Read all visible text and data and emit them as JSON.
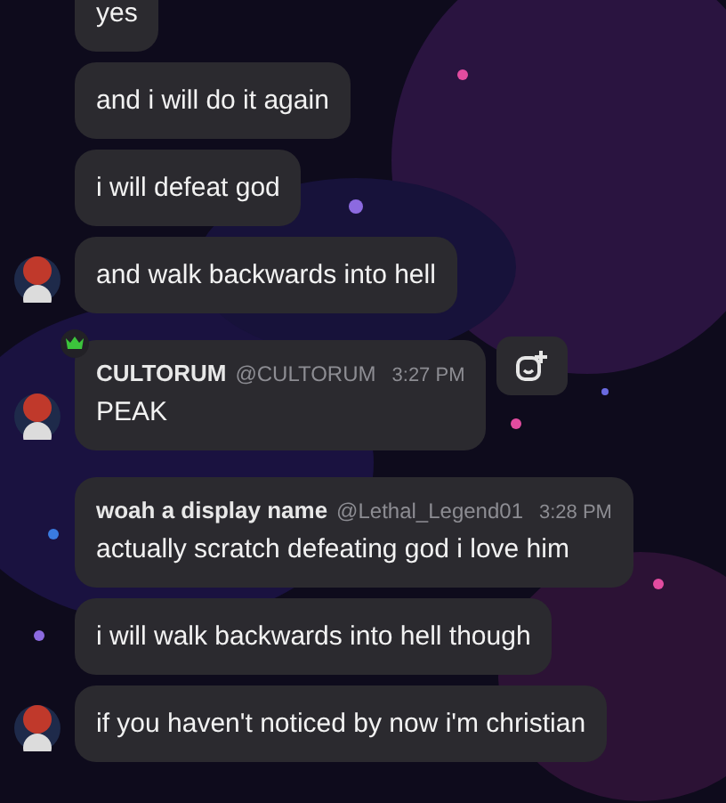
{
  "messages": [
    {
      "kind": "plain",
      "text": "yes",
      "avatar": false,
      "hovered": false
    },
    {
      "kind": "plain",
      "text": "and i will do it again",
      "avatar": false,
      "hovered": false
    },
    {
      "kind": "plain",
      "text": "i will defeat god",
      "avatar": false,
      "hovered": false
    },
    {
      "kind": "plain",
      "text": "and walk backwards into hell",
      "avatar": true,
      "hovered": false
    },
    {
      "kind": "header",
      "display_name": "CULTORUM",
      "handle": "@CULTORUM",
      "time": "3:27 PM",
      "text": "PEAK",
      "crown": true,
      "avatar": true,
      "hovered": true
    },
    {
      "kind": "header",
      "display_name": "woah a display name",
      "handle": "@Lethal_Legend01",
      "time": "3:28 PM",
      "text": "actually scratch defeating god i love him",
      "crown": false,
      "avatar": false,
      "hovered": false
    },
    {
      "kind": "plain",
      "text": "i will walk backwards into hell though",
      "avatar": false,
      "hovered": false
    },
    {
      "kind": "plain",
      "text": "if you haven't noticed by now i'm christian",
      "avatar": true,
      "hovered": false
    }
  ]
}
